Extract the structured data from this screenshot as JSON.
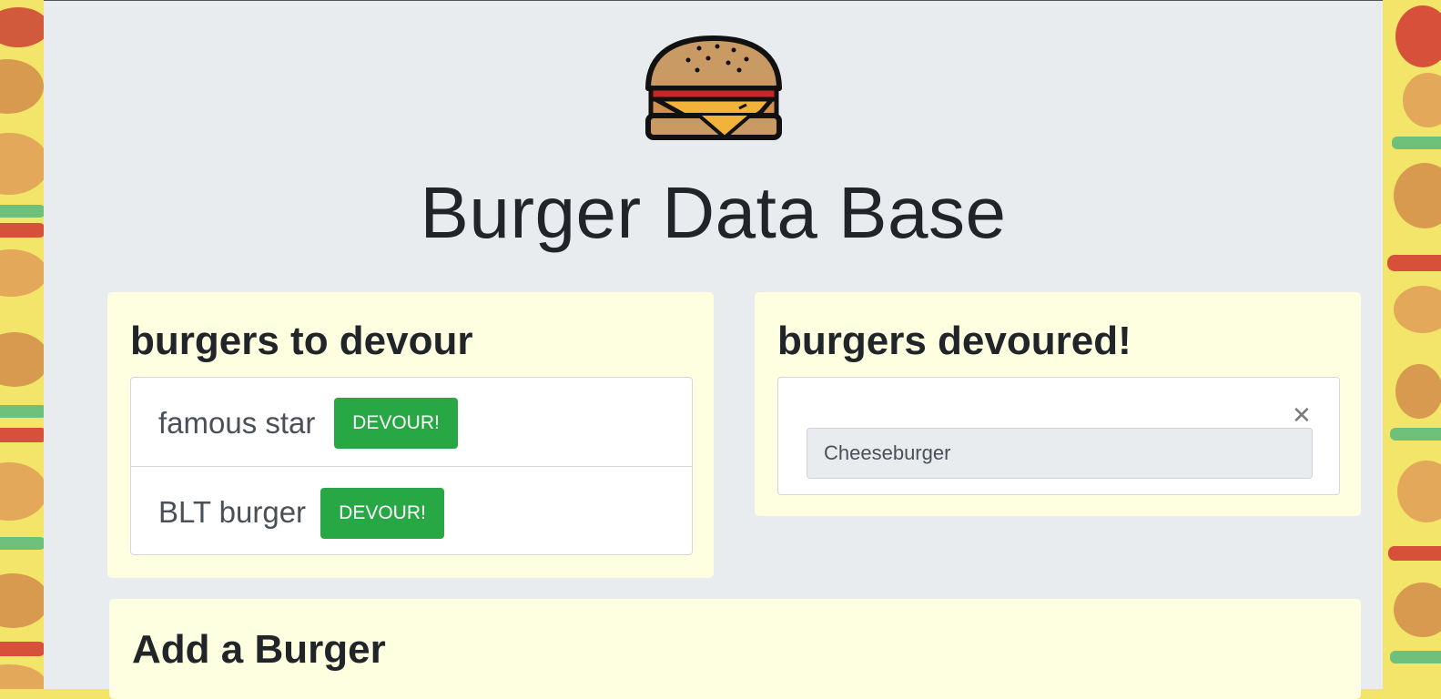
{
  "header": {
    "title": "Burger Data Base",
    "logo_icon": "burger-icon"
  },
  "to_devour": {
    "heading": "burgers to devour",
    "items": [
      {
        "name": "famous star",
        "button_label": "DEVOUR!"
      },
      {
        "name": "BLT burger",
        "button_label": "DEVOUR!"
      }
    ]
  },
  "devoured": {
    "heading": "burgers devoured!",
    "close_icon": "close-icon",
    "items": [
      {
        "name": "Cheeseburger"
      }
    ]
  },
  "add_burger": {
    "heading": "Add a Burger"
  },
  "colors": {
    "panel_bg": "#fefee1",
    "button": "#28a745",
    "jumbotron": "#e9ecef",
    "pattern": "#f3e46a"
  }
}
